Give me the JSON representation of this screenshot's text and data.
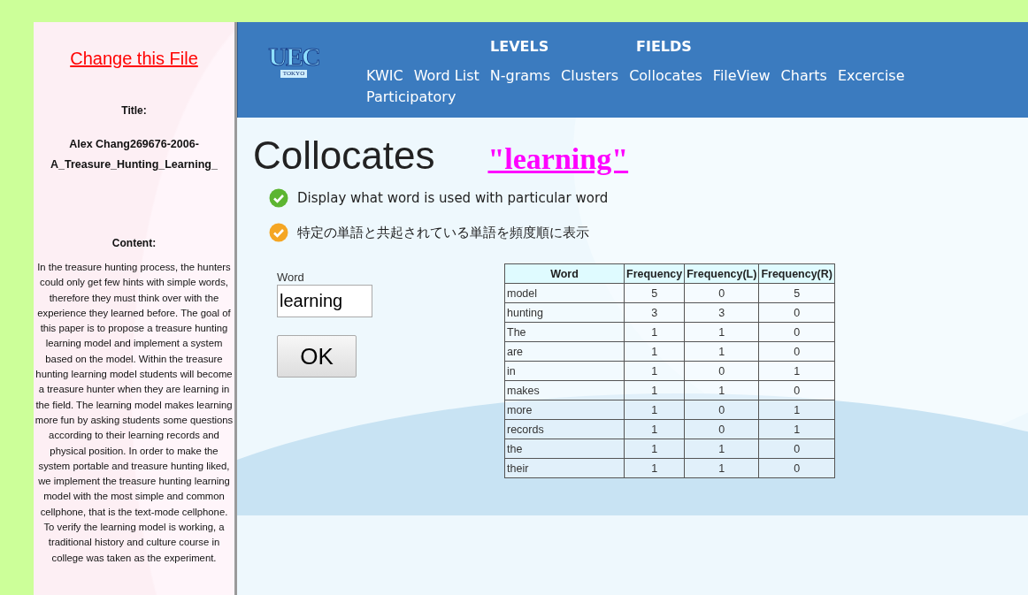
{
  "sidebar": {
    "change_link": "Change this File",
    "title_label": "Title:",
    "title": "Alex Chang269676-2006-A_Treasure_Hunting_Learning_",
    "content_label": "Content:",
    "content": "In the treasure hunting process, the hunters could only get few hints with simple words, therefore they must think over with the experience they learned before. The goal of this paper is to propose a treasure hunting learning model and implement a system based on the model. Within the treasure hunting learning model students will become a treasure hunter when they are learning in the field. The learning model makes learning more fun by asking students some questions according to their learning records and physical position. In order to make the system portable and treasure hunting liked, we implement the treasure hunting learning model with the most simple and common cellphone, that is the text-mode cellphone. To verify the learning model is working, a traditional history and culture course in college was taken as the experiment."
  },
  "header": {
    "logo": {
      "letters": "UEC",
      "sub": "TOKYO"
    },
    "menus": [
      "LEVELS",
      "FIELDS"
    ],
    "nav": [
      "KWIC",
      "Word List",
      "N-grams",
      "Clusters",
      "Collocates",
      "FileView",
      "Charts",
      "Excercise",
      "Participatory"
    ]
  },
  "page": {
    "title": "Collocates",
    "keyword": "\"learning\"",
    "notes": [
      {
        "text": "Display what word is used with particular word",
        "color": "#5cb531"
      },
      {
        "text": "特定の単語と共起されている単語を頻度順に表示",
        "color": "#f5a623"
      }
    ],
    "form": {
      "label": "Word",
      "value": "learning",
      "button": "OK"
    },
    "table": {
      "columns": [
        "Word",
        "Frequency",
        "Frequency(L)",
        "Frequency(R)"
      ],
      "rows": [
        [
          "model",
          "5",
          "0",
          "5"
        ],
        [
          "hunting",
          "3",
          "3",
          "0"
        ],
        [
          "The",
          "1",
          "1",
          "0"
        ],
        [
          "are",
          "1",
          "1",
          "0"
        ],
        [
          "in",
          "1",
          "0",
          "1"
        ],
        [
          "makes",
          "1",
          "1",
          "0"
        ],
        [
          "more",
          "1",
          "0",
          "1"
        ],
        [
          "records",
          "1",
          "0",
          "1"
        ],
        [
          "the",
          "1",
          "1",
          "0"
        ],
        [
          "their",
          "1",
          "1",
          "0"
        ]
      ]
    }
  }
}
